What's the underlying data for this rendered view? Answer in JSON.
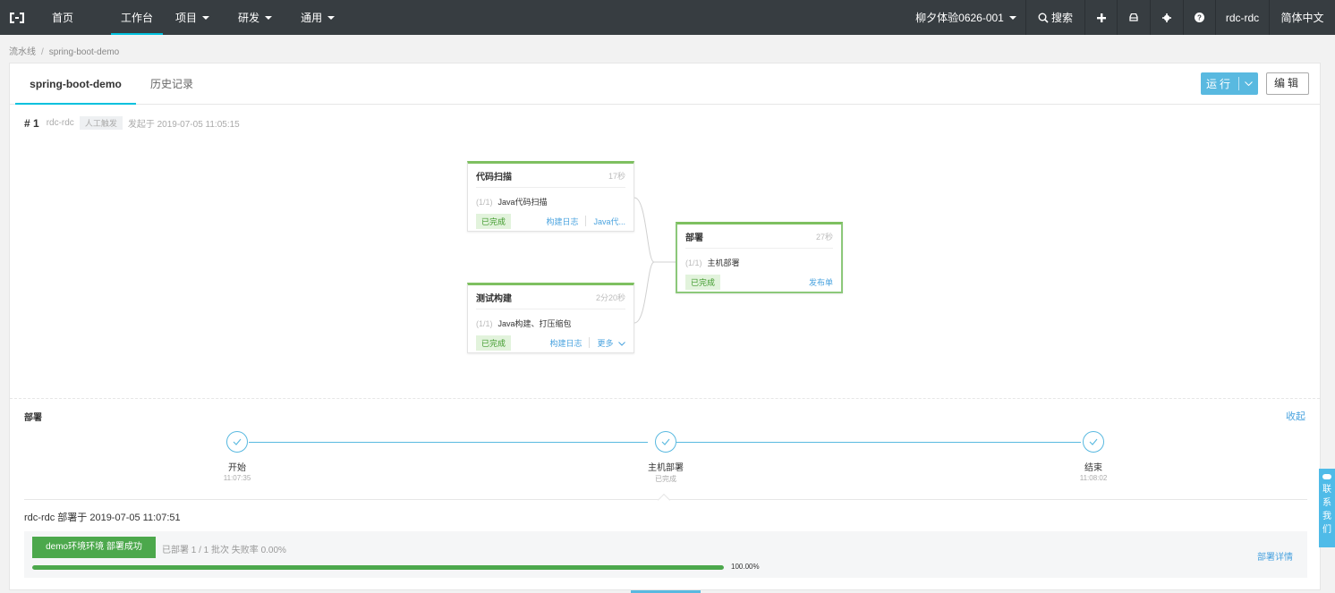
{
  "nav": {
    "items": [
      {
        "label": "首页",
        "dropdown": false,
        "active": false
      },
      {
        "label": "工作台",
        "dropdown": false,
        "active": true
      },
      {
        "label": "项目",
        "dropdown": true,
        "active": false
      },
      {
        "label": "研发",
        "dropdown": true,
        "active": false
      },
      {
        "label": "通用",
        "dropdown": true,
        "active": false
      }
    ],
    "org": "柳夕体验0626-001",
    "search": "搜索",
    "user": "rdc-rdc",
    "lang": "简体中文"
  },
  "breadcrumb": {
    "root": "流水线",
    "separator": "/",
    "current": "spring-boot-demo"
  },
  "tabs": [
    "spring-boot-demo",
    "历史记录"
  ],
  "buttons": {
    "run": "运行",
    "edit": "编辑"
  },
  "run_info": {
    "number": "# 1",
    "user": "rdc-rdc",
    "trigger": "人工触发",
    "started": "发起于 2019-07-05 11:05:15"
  },
  "stages": [
    {
      "title": "代码扫描",
      "duration": "17秒",
      "task_count": "(1/1)",
      "task": "Java代码扫描",
      "status": "已完成",
      "links": [
        "构建日志",
        "Java代..."
      ]
    },
    {
      "title": "测试构建",
      "duration": "2分20秒",
      "task_count": "(1/1)",
      "task": "Java构建、打压缩包",
      "status": "已完成",
      "links": [
        "构建日志",
        "更多"
      ]
    },
    {
      "title": "部署",
      "duration": "27秒",
      "task_count": "(1/1)",
      "task": "主机部署",
      "status": "已完成",
      "links": [
        "发布单"
      ]
    }
  ],
  "deploy": {
    "title": "部署",
    "collapse": "收起",
    "steps": [
      {
        "label": "开始",
        "sub": "11:07:35"
      },
      {
        "label": "主机部署",
        "sub": "已完成"
      },
      {
        "label": "结束",
        "sub": "11:08:02"
      }
    ],
    "deployer": "rdc-rdc 部署于 2019-07-05 11:07:51",
    "env_badge": "demo环境环境 部署成功",
    "stats": "已部署 1 / 1 批次  失败率 0.00%",
    "detail": "部署详情",
    "progress": 1.0,
    "progress_text": "100.00%"
  },
  "contact": [
    "联",
    "系",
    "我",
    "们"
  ],
  "colors": {
    "nav_bg": "#373d41",
    "accent": "#00c1de",
    "link": "#4aa3df",
    "success": "#4ca84c",
    "stage_top": "#7ec060"
  }
}
